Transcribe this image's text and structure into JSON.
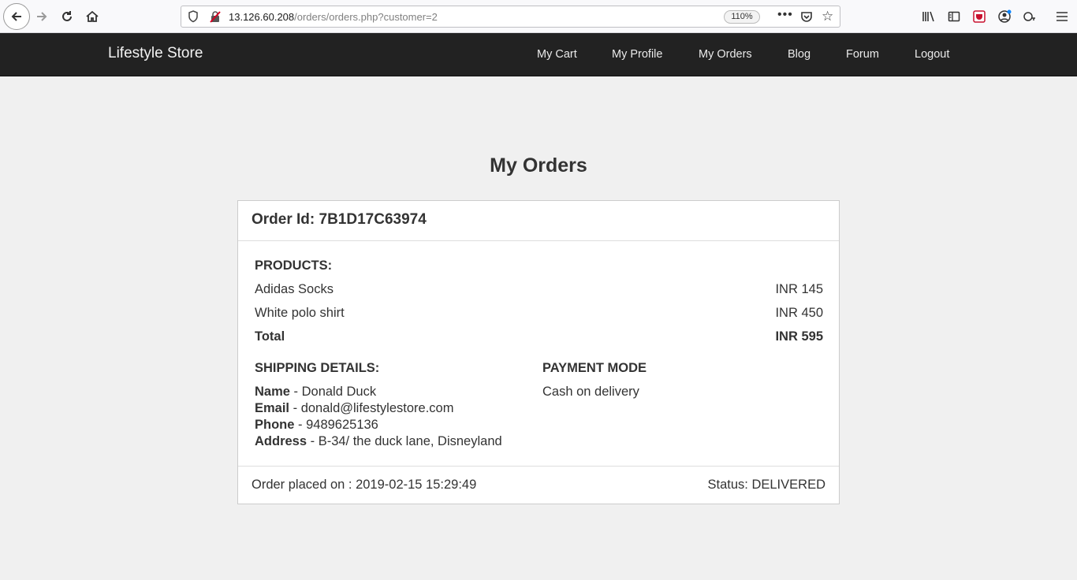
{
  "browser": {
    "url_host": "13.126.60.208",
    "url_path": "/orders/orders.php?customer=2",
    "zoom": "110%"
  },
  "site": {
    "brand": "Lifestyle Store",
    "nav": [
      "My Cart",
      "My Profile",
      "My Orders",
      "Blog",
      "Forum",
      "Logout"
    ]
  },
  "page": {
    "title": "My Orders"
  },
  "order": {
    "id_label": "Order Id: 7B1D17C63974",
    "products_label": "PRODUCTS:",
    "products": [
      {
        "name": "Adidas Socks",
        "price": "INR 145"
      },
      {
        "name": "White polo shirt",
        "price": "INR 450"
      }
    ],
    "total_label": "Total",
    "total_value": "INR 595",
    "shipping_label": "SHIPPING DETAILS:",
    "shipping": [
      {
        "key": "Name",
        "value": " - Donald Duck"
      },
      {
        "key": "Email",
        "value": " - donald@lifestylestore.com"
      },
      {
        "key": "Phone",
        "value": " - 9489625136"
      },
      {
        "key": "Address",
        "value": " - B-34/ the duck lane, Disneyland"
      }
    ],
    "payment_label": "PAYMENT MODE",
    "payment_value": "Cash on delivery",
    "placed_on": "Order placed on : 2019-02-15 15:29:49",
    "status": "Status: DELIVERED"
  }
}
